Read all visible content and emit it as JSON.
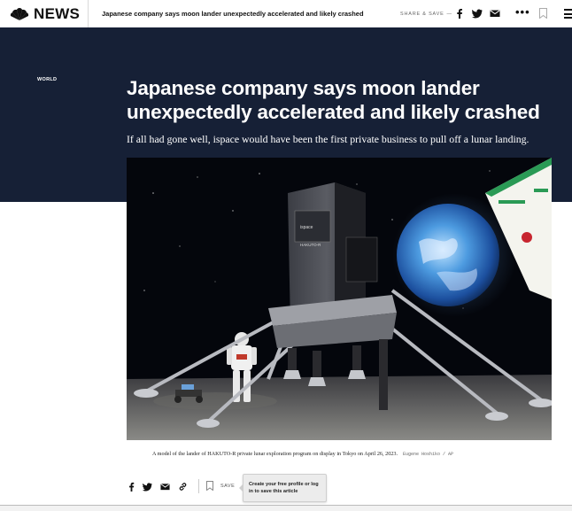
{
  "topbar": {
    "logo_text": "NEWS",
    "headline": "Japanese company says moon lander unexpectedly accelerated and likely crashed",
    "share_label": "SHARE & SAVE",
    "share_chevron": "—",
    "more_glyph": "•••",
    "icons": [
      "nbc-peacock-icon",
      "facebook-icon",
      "twitter-icon",
      "email-icon",
      "more-icon",
      "bookmark-icon",
      "menu-icon"
    ]
  },
  "hero": {
    "section": "WORLD",
    "title": "Japanese company says moon lander unexpectedly accelerated and likely crashed",
    "dek": "If all had gone well, ispace would have been the first private business to pull off a lunar landing.",
    "background_color": "#162036"
  },
  "photo": {
    "caption": "A model of the lander of HAKUTO-R private lunar exploration program on display in Tokyo on April 26, 2023.",
    "credit": "Eugene Hoshiko / AP"
  },
  "share_row": {
    "icons": [
      "facebook-icon",
      "twitter-icon",
      "email-icon",
      "link-icon",
      "bookmark-icon"
    ],
    "save_label": "SAVE",
    "tooltip": "Create your free profile or log in to save this article"
  },
  "colors": {
    "hero_bg": "#162036",
    "text_dark": "#111111",
    "tooltip_bg": "#ececec"
  }
}
